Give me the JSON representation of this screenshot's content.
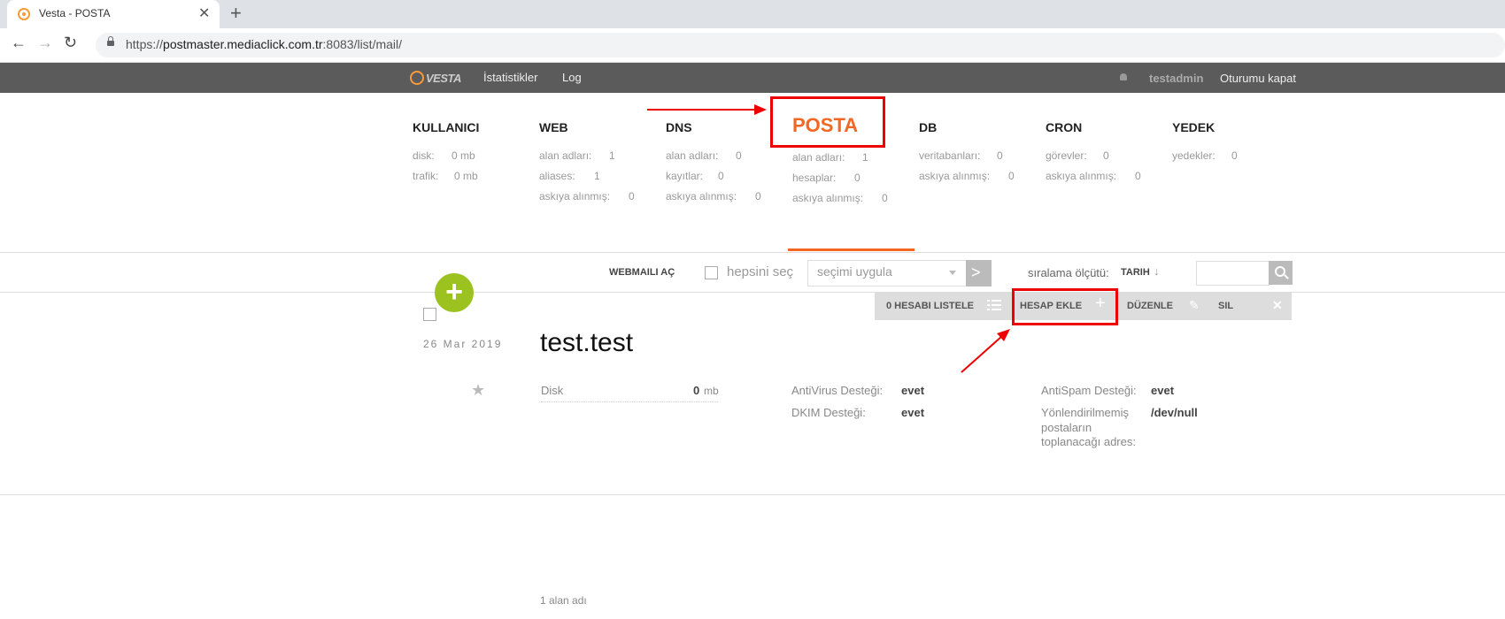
{
  "browser": {
    "tab_title": "Vesta - POSTA",
    "url_prefix": "https://",
    "url_host": "postmaster.mediaclick.com.tr",
    "url_rest": ":8083/list/mail/"
  },
  "topnav": {
    "logo": "VESTA",
    "links": [
      "İstatistikler",
      "Log"
    ],
    "username": "testadmin",
    "logout": "Oturumu kapat"
  },
  "stats": {
    "kullanici": {
      "title": "KULLANICI",
      "rows": [
        {
          "label": "disk:",
          "value": "0 mb"
        },
        {
          "label": "trafik:",
          "value": "0 mb"
        }
      ]
    },
    "web": {
      "title": "WEB",
      "rows": [
        {
          "label": "alan adları:",
          "value": "1"
        },
        {
          "label": "aliases:",
          "value": "1"
        },
        {
          "label": "askıya alınmış:",
          "value": "0"
        }
      ]
    },
    "dns": {
      "title": "DNS",
      "rows": [
        {
          "label": "alan adları:",
          "value": "0"
        },
        {
          "label": "kayıtlar:",
          "value": "0"
        },
        {
          "label": "askıya alınmış:",
          "value": "0"
        }
      ]
    },
    "posta": {
      "title": "POSTA",
      "rows": [
        {
          "label": "alan adları:",
          "value": "1"
        },
        {
          "label": "hesaplar:",
          "value": "0"
        },
        {
          "label": "askıya alınmış:",
          "value": "0"
        }
      ]
    },
    "db": {
      "title": "DB",
      "rows": [
        {
          "label": "veritabanları:",
          "value": "0"
        },
        {
          "label": "askıya alınmış:",
          "value": "0"
        }
      ]
    },
    "cron": {
      "title": "CRON",
      "rows": [
        {
          "label": "görevler:",
          "value": "0"
        },
        {
          "label": "askıya alınmış:",
          "value": "0"
        }
      ]
    },
    "yedek": {
      "title": "YEDEK",
      "rows": [
        {
          "label": "yedekler:",
          "value": "0"
        }
      ]
    }
  },
  "toolbar": {
    "webmail": "WEBMAILI AÇ",
    "select_all": "hepsini seç",
    "apply_placeholder": "seçimi uygula",
    "sort_label": "sıralama ölçütü:",
    "sort_value": "TARIH",
    "sort_arrow": "↓"
  },
  "row": {
    "date": "26 Mar 2019",
    "domain": "test.test",
    "actions": {
      "list": "0 HESABI LISTELE",
      "add": "HESAP EKLE",
      "edit": "DÜZENLE",
      "delete": "SIL"
    },
    "disk_label": "Disk",
    "disk_value": "0",
    "disk_unit": "mb",
    "antivirus_label": "AntiVirus Desteği:",
    "antivirus_value": "evet",
    "dkim_label": "DKIM Desteği:",
    "dkim_value": "evet",
    "antispam_label": "AntiSpam Desteği:",
    "antispam_value": "evet",
    "catchall_label_1": "Yönlendirilmemiş",
    "catchall_label_2": "postaların",
    "catchall_label_3": "toplanacağı adres:",
    "catchall_value": "/dev/null"
  },
  "footer": {
    "count": "1 alan adı"
  },
  "colors": {
    "accent": "#f26722",
    "add_button": "#9cc21f",
    "annotation": "#ee0000",
    "topnav": "#5b5b5b"
  }
}
